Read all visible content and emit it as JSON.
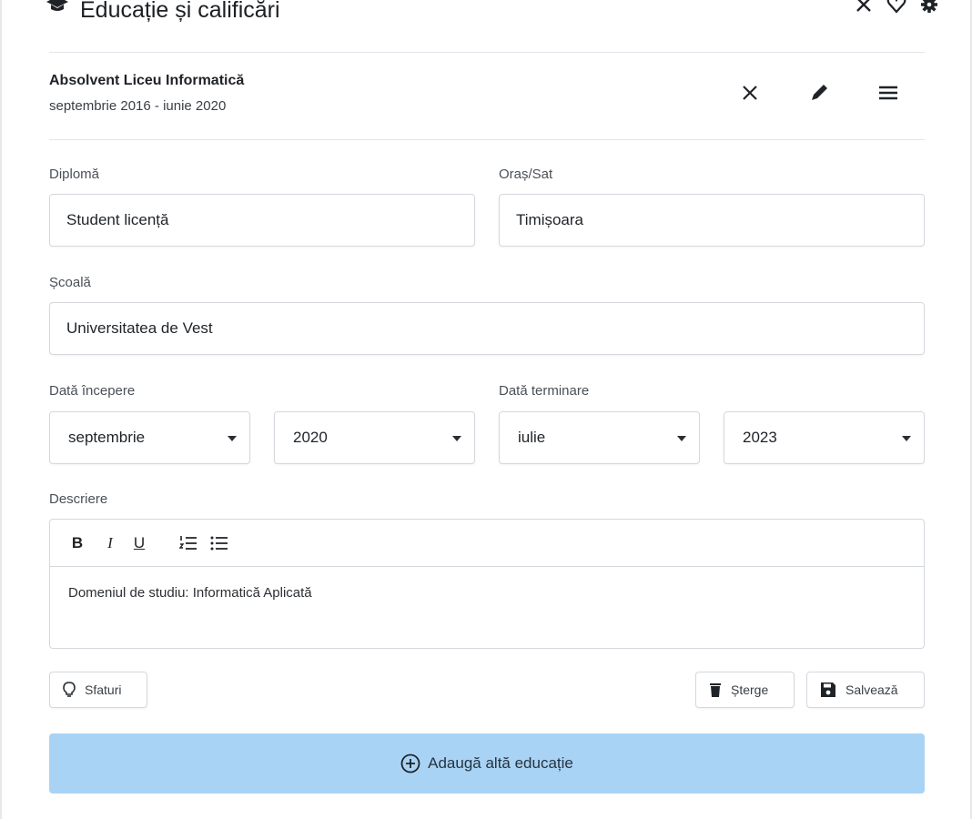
{
  "header": {
    "title": "Educație și calificări",
    "icon": "graduation-cap-icon",
    "actions": [
      "close-icon",
      "heart-icon",
      "gear-icon"
    ]
  },
  "entry": {
    "title": "Absolvent Liceu Informatică",
    "dates": "septembrie 2016 - iunie 2020"
  },
  "form": {
    "degree": {
      "label": "Diplomă",
      "value": "Student licență"
    },
    "city": {
      "label": "Oraș/Sat",
      "value": "Timișoara"
    },
    "school": {
      "label": "Școală",
      "value": "Universitatea de Vest"
    },
    "start_date": {
      "label": "Dată începere",
      "month": "septembrie",
      "year": "2020"
    },
    "end_date": {
      "label": "Dată terminare",
      "month": "iulie",
      "year": "2023"
    },
    "description": {
      "label": "Descriere",
      "toolbar": [
        "B",
        "I",
        "U"
      ],
      "text": "Domeniul de studiu: Informatică Aplicată"
    }
  },
  "buttons": {
    "tips": "Sfaturi",
    "delete": "Șterge",
    "save": "Salvează",
    "add_more": "Adaugă altă educație"
  },
  "colors": {
    "accent": "#a9d3f5",
    "border": "#d4d8dd"
  }
}
